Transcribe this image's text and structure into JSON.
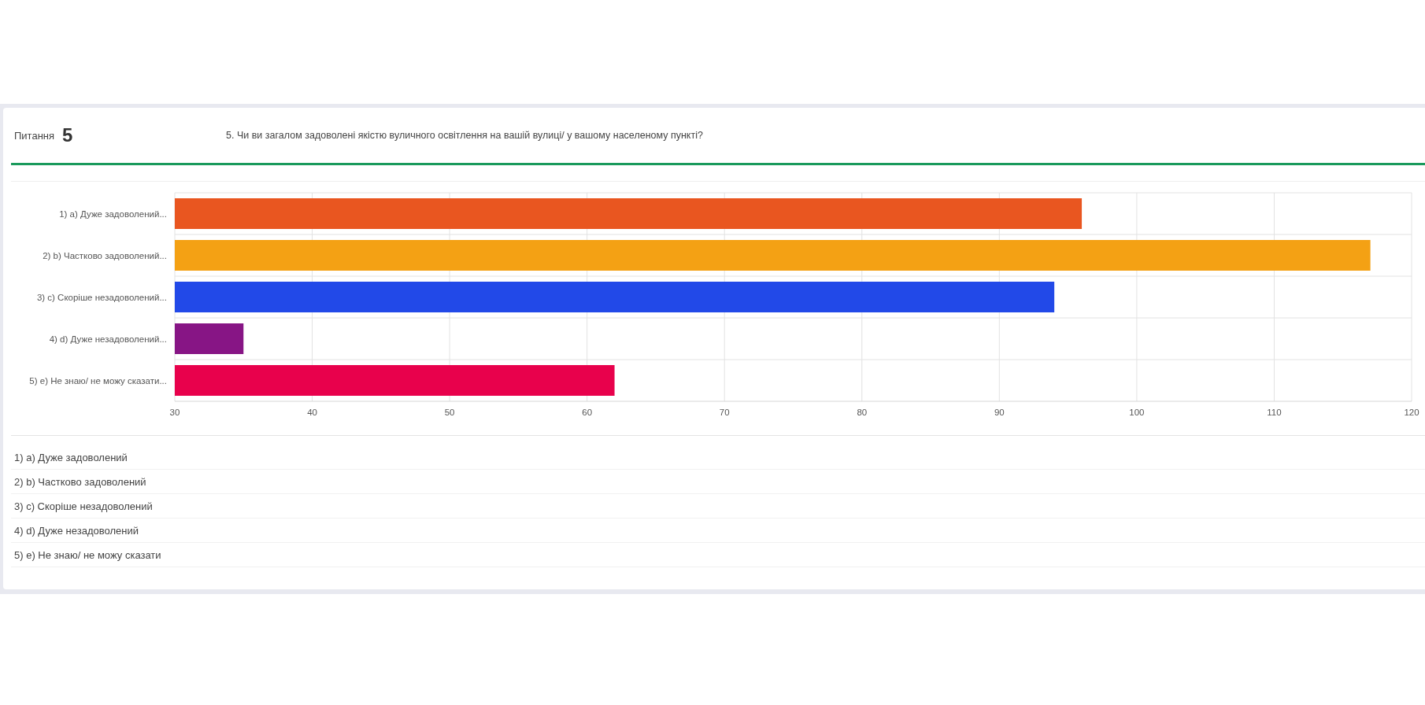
{
  "question": {
    "label": "Питання",
    "number": "5",
    "text": "5. Чи ви загалом задоволені якістю вуличного освітлення на вашій вулиці/ у вашому населеному пункті?"
  },
  "chart": {
    "chart_data": {
      "type": "bar",
      "orientation": "horizontal",
      "categories": [
        "1) a) Дуже задоволений...",
        "2) b) Частково задоволений...",
        "3) c) Скоріше незадоволений...",
        "4) d) Дуже незадоволений...",
        "5) e) Не знаю/ не можу сказати..."
      ],
      "series": [
        {
          "values": [
            96,
            117,
            94,
            35,
            62
          ],
          "colors": [
            "#e95620",
            "#f4a114",
            "#2249e8",
            "#871585",
            "#e8014c"
          ]
        }
      ],
      "grid": true,
      "xlim": [
        30,
        120
      ],
      "xticks": [
        30,
        40,
        50,
        60,
        70,
        80,
        90,
        100,
        110,
        120
      ]
    }
  },
  "answers": [
    "1) a) Дуже задоволений",
    "2) b) Частково задоволений",
    "3) c) Скоріше незадоволений",
    "4) d) Дуже незадоволений",
    "5) e) Не знаю/ не можу сказати"
  ]
}
